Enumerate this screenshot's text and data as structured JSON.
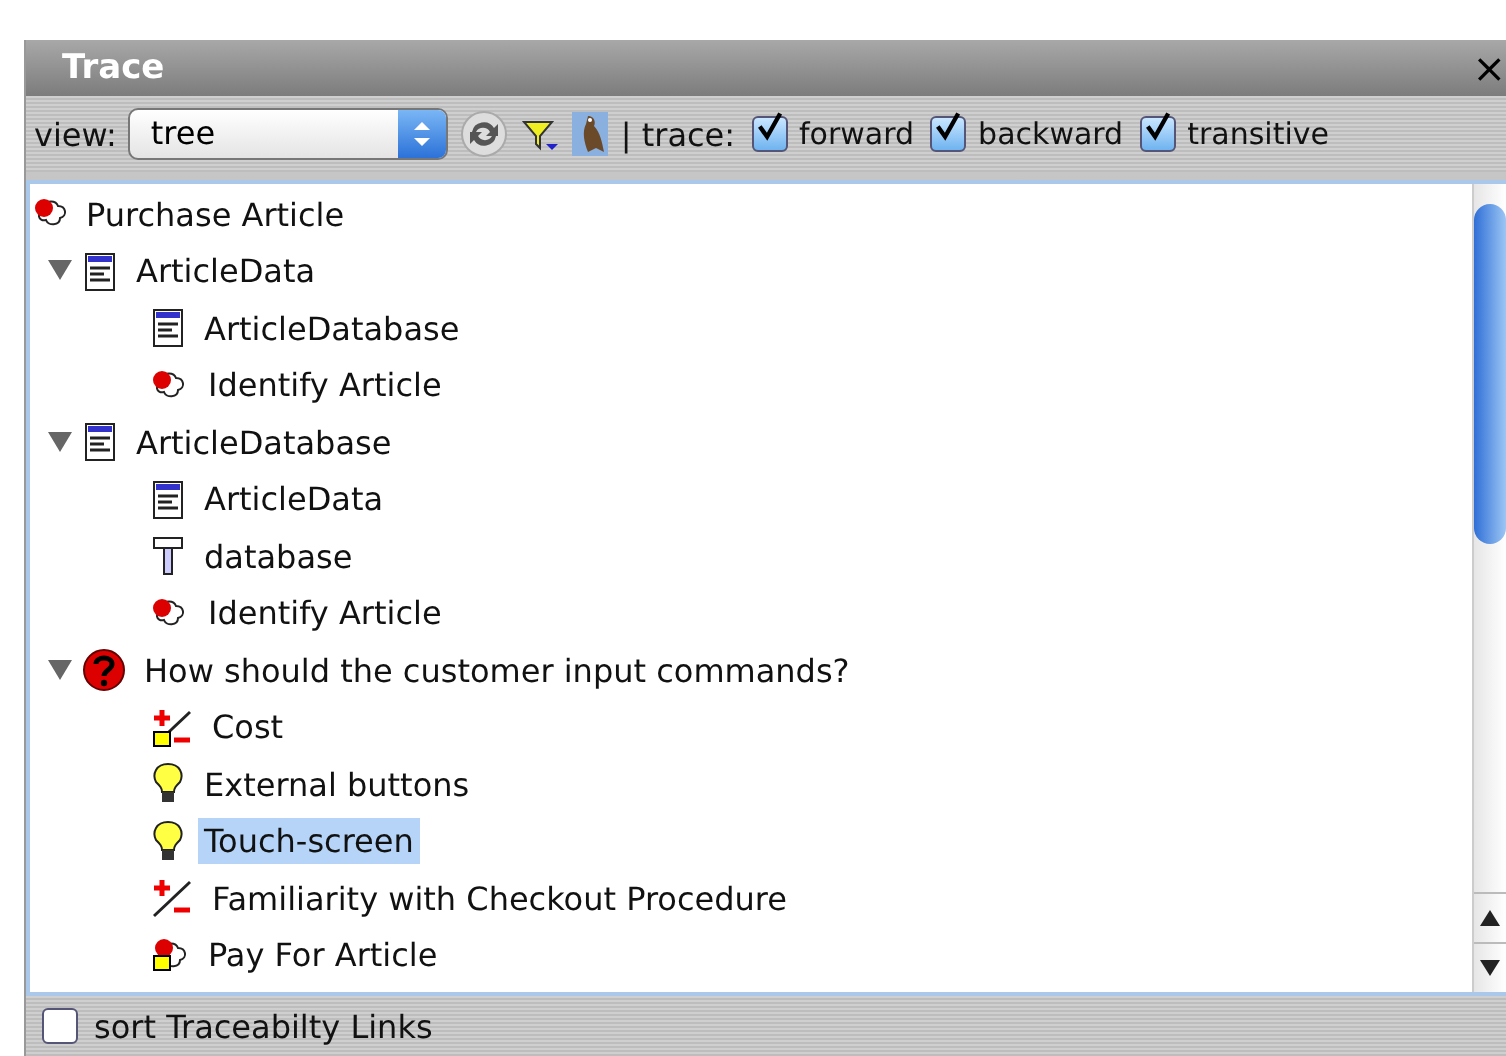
{
  "window": {
    "title": "Trace",
    "close": "×"
  },
  "toolbar": {
    "view_label": "view:",
    "view_value": "tree",
    "trace_label": "| trace:",
    "filter_pressed": false,
    "bird_pressed": true,
    "trace_options": [
      {
        "label": "forward",
        "checked": true
      },
      {
        "label": "backward",
        "checked": true
      },
      {
        "label": "transitive",
        "checked": true
      }
    ]
  },
  "tree": [
    {
      "label": "Purchase Article",
      "kind": "task",
      "selected": false,
      "children": [
        {
          "label": "ArticleData",
          "kind": "class",
          "selected": false,
          "expanded": true,
          "children": [
            {
              "label": "ArticleDatabase",
              "kind": "class",
              "selected": false
            },
            {
              "label": "Identify Article",
              "kind": "task",
              "selected": false
            }
          ]
        },
        {
          "label": "ArticleDatabase",
          "kind": "class",
          "selected": false,
          "expanded": true,
          "children": [
            {
              "label": "ArticleData",
              "kind": "class",
              "selected": false
            },
            {
              "label": "database",
              "kind": "attribute",
              "selected": false
            },
            {
              "label": "Identify Article",
              "kind": "task",
              "selected": false
            }
          ]
        },
        {
          "label": "How should the customer input commands?",
          "kind": "question",
          "selected": false,
          "expanded": true,
          "children": [
            {
              "label": "Cost",
              "kind": "criterion_assessed",
              "selected": false
            },
            {
              "label": "External buttons",
              "kind": "proposal",
              "selected": false
            },
            {
              "label": "Touch-screen",
              "kind": "proposal",
              "selected": true
            },
            {
              "label": "Familiarity with Checkout Procedure",
              "kind": "criterion",
              "selected": false
            },
            {
              "label": "Pay For Article",
              "kind": "task_assessed",
              "selected": false
            }
          ]
        }
      ]
    }
  ],
  "bottom": {
    "label": "sort Traceabilty Links",
    "checked": false
  }
}
